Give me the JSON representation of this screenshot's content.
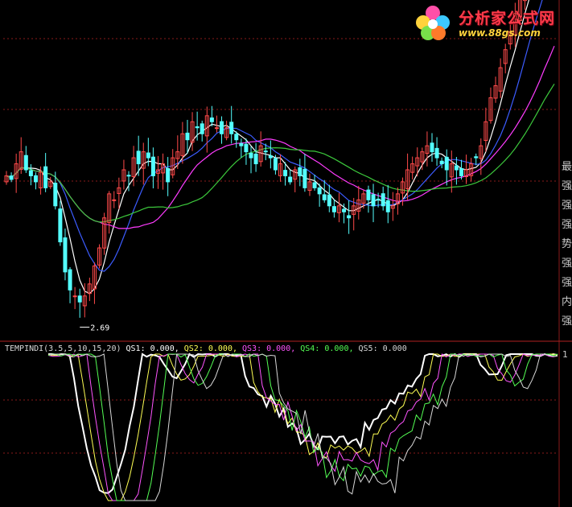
{
  "logo": {
    "name_cn": "分析家公式网",
    "url": "www.88gs.com"
  },
  "colors": {
    "background": "#000000",
    "up_candle": "#ff4a4a",
    "down_candle": "#54ffff",
    "ma_short": "#ffffff",
    "ma_mid": "#3c5cff",
    "ma_long1": "#ff3cff",
    "ma_long2": "#3cc83c",
    "qs1": "#ffffff",
    "qs2": "#ffff54",
    "qs3": "#ff54ff",
    "qs4": "#54ff54",
    "qs5": "#d8d8d8"
  },
  "side_labels": [
    "最",
    "强",
    "强",
    "强",
    "势",
    "强",
    "强",
    "内",
    "强"
  ],
  "chart_data": [
    {
      "type": "candlestick",
      "panel": "main",
      "annotations": [
        {
          "text": "2.69",
          "x": 15,
          "y": 2.69
        }
      ],
      "ylim": [
        2.6,
        5.4
      ],
      "x": [
        0,
        1,
        2,
        3,
        4,
        5,
        6,
        7,
        8,
        9,
        10,
        11,
        12,
        13,
        14,
        15,
        16,
        17,
        18,
        19,
        20,
        21,
        22,
        23,
        24,
        25,
        26,
        27,
        28,
        29,
        30,
        31,
        32,
        33,
        34,
        35,
        36,
        37,
        38,
        39,
        40,
        41,
        42,
        43,
        44,
        45,
        46,
        47,
        48,
        49,
        50,
        51,
        52,
        53,
        54,
        55,
        56,
        57,
        58,
        59,
        60,
        61,
        62,
        63,
        64,
        65,
        66,
        67,
        68,
        69,
        69,
        70,
        71,
        72,
        73,
        74,
        75,
        76,
        77,
        78,
        79,
        80,
        81,
        82,
        83,
        84,
        85,
        86,
        87,
        88,
        89,
        90,
        91,
        92,
        93,
        94,
        95,
        96,
        97,
        98,
        99,
        100,
        101,
        102,
        103,
        104,
        105,
        106,
        107,
        108,
        109,
        110,
        111,
        112
      ],
      "close": [
        3.95,
        3.92,
        4.05,
        4.15,
        4.0,
        3.95,
        3.9,
        3.98,
        3.85,
        3.9,
        3.7,
        3.4,
        3.15,
        3.0,
        2.95,
        2.9,
        2.95,
        3.05,
        3.2,
        3.35,
        3.6,
        3.8,
        3.75,
        3.85,
        4.0,
        3.95,
        4.1,
        4.05,
        4.15,
        4.1,
        3.95,
        4.0,
        4.05,
        3.9,
        4.1,
        4.15,
        4.3,
        4.25,
        4.4,
        4.35,
        4.3,
        4.45,
        4.4,
        4.35,
        4.3,
        4.35,
        4.3,
        4.25,
        4.2,
        4.15,
        4.1,
        4.05,
        4.2,
        4.15,
        4.1,
        4.0,
        4.05,
        3.95,
        3.9,
        4.0,
        3.95,
        3.85,
        3.9,
        3.85,
        3.8,
        3.75,
        3.7,
        3.65,
        3.7,
        3.65,
        3.6,
        3.7,
        3.75,
        3.8,
        3.75,
        3.7,
        3.75,
        3.7,
        3.65,
        3.7,
        3.8,
        3.9,
        4.0,
        4.05,
        4.1,
        4.15,
        4.2,
        4.15,
        4.1,
        4.05,
        4.0,
        4.05,
        4.0,
        3.95,
        4.0,
        4.05,
        4.1,
        4.2,
        4.4,
        4.6,
        4.7,
        4.85,
        5.0,
        5.15,
        5.3,
        5.45,
        5.6,
        5.7,
        5.8,
        5.9,
        6.0,
        5.9,
        5.95
      ],
      "series": [
        {
          "name": "MA5",
          "color_key": "ma_short"
        },
        {
          "name": "MA10",
          "color_key": "ma_mid"
        },
        {
          "name": "MA20",
          "color_key": "ma_long1"
        },
        {
          "name": "MA30",
          "color_key": "ma_long2"
        }
      ]
    },
    {
      "type": "line",
      "panel": "indicator",
      "title": "TEMPINDI(3.5,5,10,15,20)",
      "ylim": [
        0,
        1
      ],
      "yticks": [
        "1"
      ],
      "legend": [
        {
          "label": "QS1: 0.000,",
          "color_key": "qs1"
        },
        {
          "label": "QS2: 0.000,",
          "color_key": "qs2"
        },
        {
          "label": "QS3: 0.000,",
          "color_key": "qs3"
        },
        {
          "label": "QS4: 0.000,",
          "color_key": "qs4"
        },
        {
          "label": "QS5: 0.000",
          "color_key": "qs5"
        }
      ],
      "series": [
        {
          "name": "QS1",
          "color_key": "qs1"
        },
        {
          "name": "QS2",
          "color_key": "qs2"
        },
        {
          "name": "QS3",
          "color_key": "qs3"
        },
        {
          "name": "QS4",
          "color_key": "qs4"
        },
        {
          "name": "QS5",
          "color_key": "qs5"
        }
      ]
    }
  ]
}
